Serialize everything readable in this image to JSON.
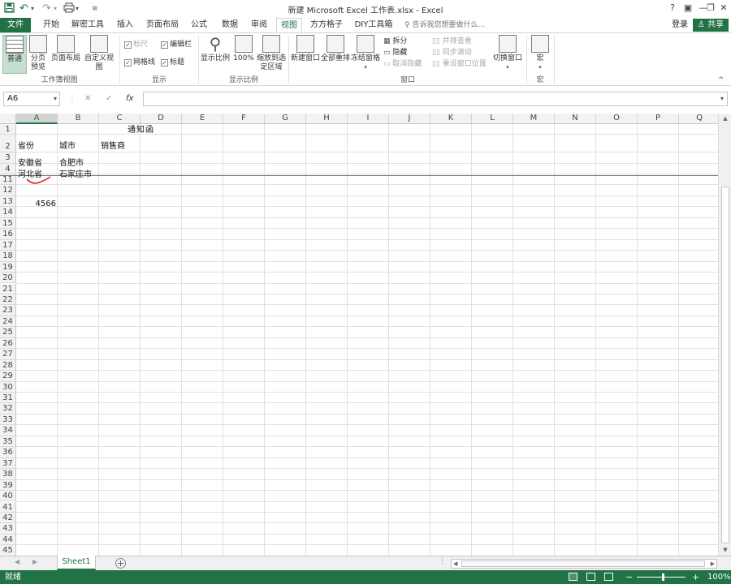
{
  "titlebar": {
    "title": "新建 Microsoft Excel 工作表.xlsx - Excel",
    "save_icon": "save-icon",
    "undo": "↶",
    "redo": "↷",
    "help": "?",
    "restore_ribbon": "▣",
    "minimize": "—",
    "maximize": "❐",
    "close": "✕"
  },
  "tabs": [
    "文件",
    "开始",
    "解密工具",
    "插入",
    "页面布局",
    "公式",
    "数据",
    "审阅",
    "视图",
    "方方格子",
    "DIY工具箱"
  ],
  "active_tab": "视图",
  "tellme": "告诉我您想要做什么...",
  "login": "登录",
  "share": "共享",
  "ribbon": {
    "normal": "普通",
    "page_break": "分页预览",
    "page_layout": "页面布局",
    "custom_view": "自定义视图",
    "ruler": "标尺",
    "formula_bar": "编辑栏",
    "gridlines": "网格线",
    "headings": "标题",
    "zoom": "显示比例",
    "zoom100": "100%",
    "zoom_sel": "缩放到选定区域",
    "new_window": "新建窗口",
    "arrange_all": "全部重排",
    "freeze": "冻结窗格",
    "split": "拆分",
    "hide": "隐藏",
    "unhide": "取消隐藏",
    "side_by_side": "并排查看",
    "sync_scroll": "同步滚动",
    "reset_pos": "重设窗口位置",
    "switch_window": "切换窗口",
    "macro": "宏",
    "groups": {
      "workbook_views": "工作簿视图",
      "show": "显示",
      "zoom": "显示比例",
      "window": "窗口",
      "macros": "宏"
    },
    "collapse": "^"
  },
  "formula": {
    "namebox": "A6",
    "cancel": "✕",
    "enter": "✓",
    "fx": "fx",
    "value": ""
  },
  "columns": [
    "A",
    "B",
    "C",
    "D",
    "E",
    "F",
    "G",
    "H",
    "I",
    "J",
    "K",
    "L",
    "M",
    "N",
    "O",
    "P",
    "Q"
  ],
  "rows": [
    "1",
    "2",
    "3",
    "4",
    "11",
    "12",
    "13",
    "14",
    "15",
    "16",
    "17",
    "18",
    "19",
    "20",
    "21",
    "22",
    "23",
    "24",
    "25",
    "26",
    "27",
    "28",
    "29",
    "30",
    "31",
    "32",
    "33",
    "34",
    "35",
    "36",
    "37",
    "38",
    "39",
    "40",
    "41",
    "42",
    "43",
    "44",
    "45"
  ],
  "cells": {
    "C1": "通知函",
    "A2": "省份",
    "B2": "城市",
    "C2": "销售商",
    "A3": "安徽省",
    "B3": "合肥市",
    "A4": "河北省",
    "B4": "石家庄市",
    "A13": "4566"
  },
  "sheets": [
    "Sheet1"
  ],
  "status": {
    "ready": "就绪",
    "zoom": "100%",
    "minus": "−",
    "plus": "+"
  }
}
